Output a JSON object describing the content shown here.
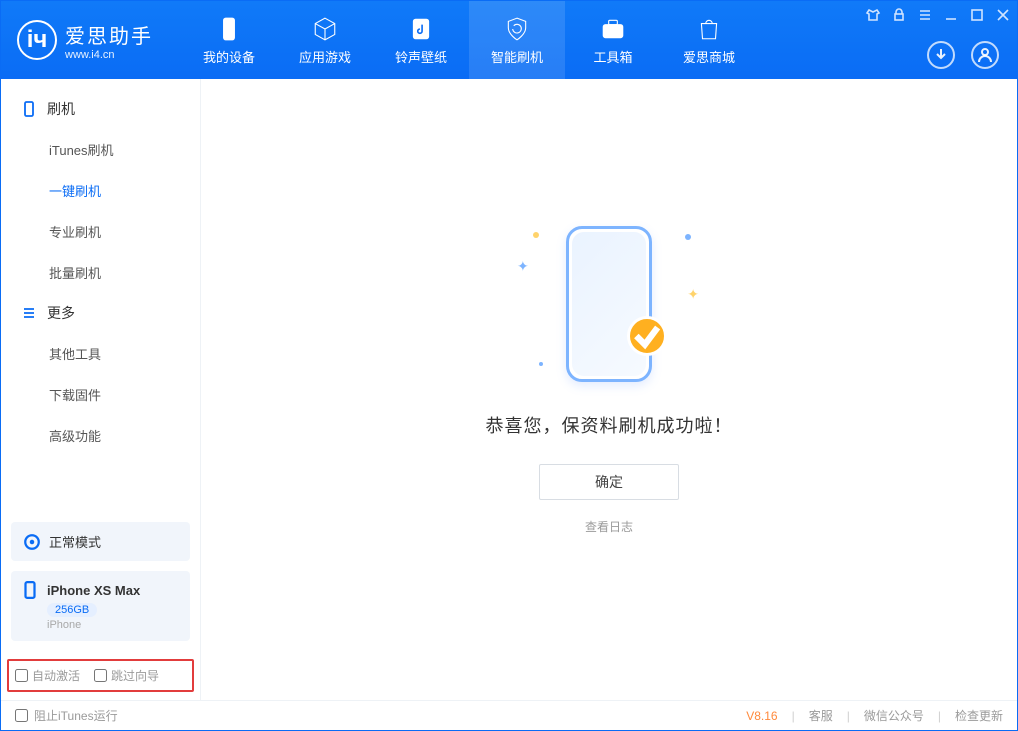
{
  "app": {
    "name_cn": "爱思助手",
    "name_en": "www.i4.cn"
  },
  "nav": {
    "items": [
      {
        "label": "我的设备"
      },
      {
        "label": "应用游戏"
      },
      {
        "label": "铃声壁纸"
      },
      {
        "label": "智能刷机"
      },
      {
        "label": "工具箱"
      },
      {
        "label": "爱思商城"
      }
    ],
    "active_index": 3
  },
  "sidebar": {
    "groups": [
      {
        "title": "刷机",
        "items": [
          {
            "label": "iTunes刷机"
          },
          {
            "label": "一键刷机"
          },
          {
            "label": "专业刷机"
          },
          {
            "label": "批量刷机"
          }
        ],
        "active_index": 1
      },
      {
        "title": "更多",
        "items": [
          {
            "label": "其他工具"
          },
          {
            "label": "下载固件"
          },
          {
            "label": "高级功能"
          }
        ]
      }
    ],
    "mode": {
      "label": "正常模式"
    },
    "device": {
      "name": "iPhone XS Max",
      "capacity": "256GB",
      "type": "iPhone"
    },
    "checks": {
      "auto_activate": "自动激活",
      "skip_guide": "跳过向导"
    }
  },
  "main": {
    "success_text": "恭喜您，保资料刷机成功啦！",
    "ok_button": "确定",
    "view_log": "查看日志"
  },
  "footer": {
    "block_itunes": "阻止iTunes运行",
    "version": "V8.16",
    "links": {
      "service": "客服",
      "wechat": "微信公众号",
      "update": "检查更新"
    }
  }
}
